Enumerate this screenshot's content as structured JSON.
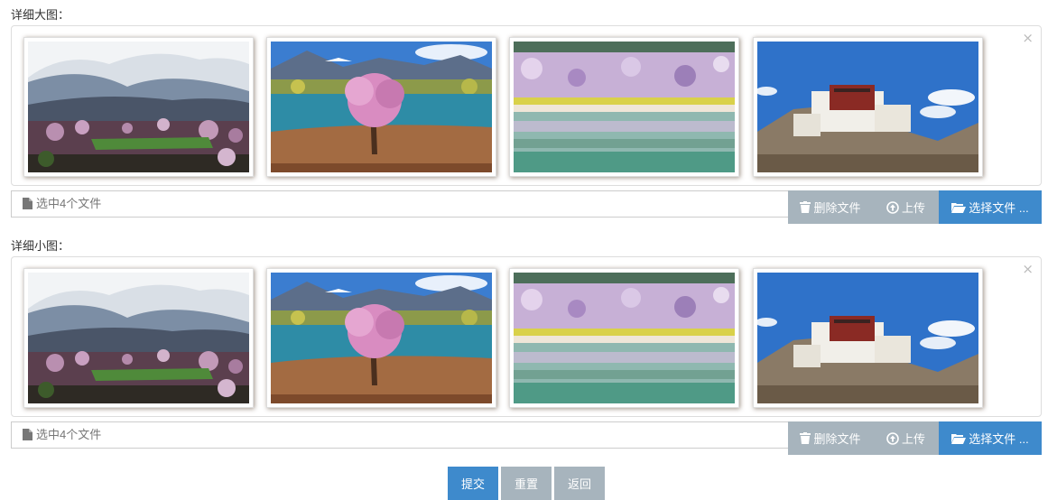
{
  "large_section": {
    "label": "详细大图：",
    "caption": "选中4个文件",
    "remove_label": "删除文件",
    "upload_label": "上传",
    "browse_label": "选择文件 ..."
  },
  "small_section": {
    "label": "详细小图：",
    "caption": "选中4个文件",
    "remove_label": "删除文件",
    "upload_label": "上传",
    "browse_label": "选择文件 ..."
  },
  "close_symbol": "×",
  "actions": {
    "submit": "提交",
    "reset": "重置",
    "back": "返回"
  },
  "colors": {
    "primary": "#3e8acc",
    "muted": "#a7b4bd"
  }
}
